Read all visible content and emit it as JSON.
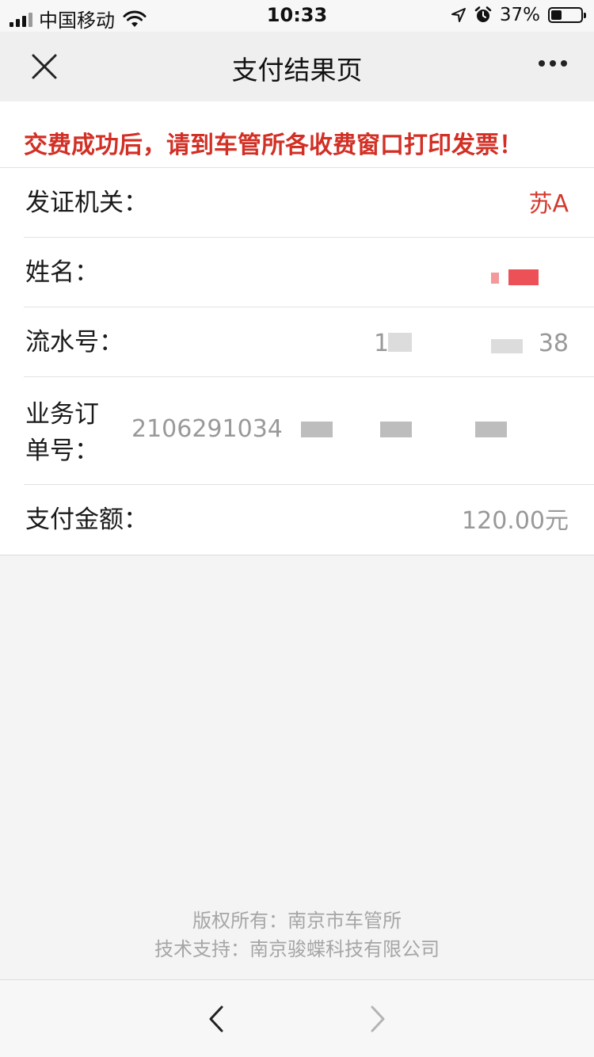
{
  "status_bar": {
    "carrier": "中国移动",
    "time": "10:33",
    "battery_percent": "37%",
    "battery_level": 0.37
  },
  "nav": {
    "title": "支付结果页"
  },
  "notice": {
    "text": "交费成功后，请到车管所各收费窗口打印发票！",
    "color": "#d22f25"
  },
  "info": {
    "issuing_authority_label": "发证机关：",
    "issuing_authority_value": "苏A",
    "name_label": "姓名：",
    "serial_label": "流水号：",
    "serial_start": "1",
    "serial_end": "38",
    "order_label": "业务订单号：",
    "order_value": "2106291034",
    "amount_label": "支付金额：",
    "amount_value": "120.00元"
  },
  "footer": {
    "copyright": "版权所有：南京市车管所",
    "support": "技术支持：南京骏蝶科技有限公司"
  },
  "icons": {
    "close": "close-icon",
    "more": "more-icon",
    "back": "chevron-left-icon",
    "forward": "chevron-right-icon"
  }
}
